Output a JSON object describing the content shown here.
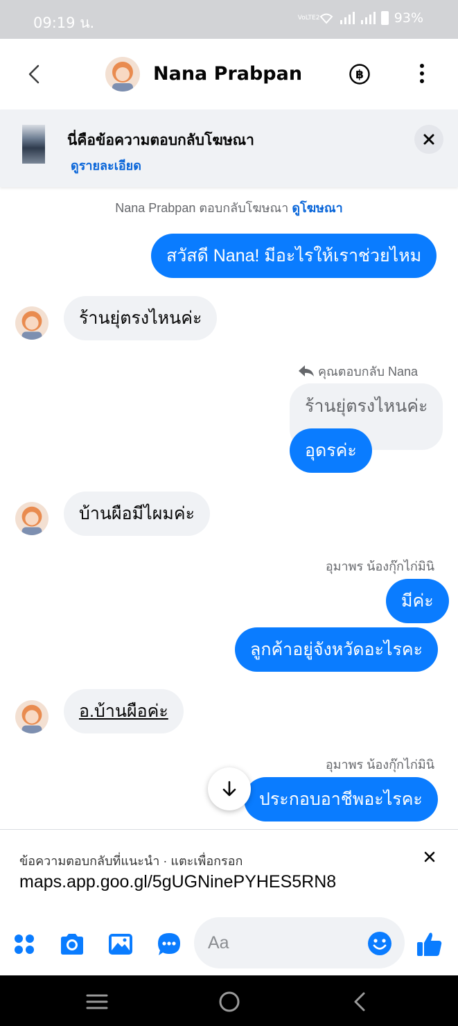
{
  "status_bar": {
    "time": "09:19 น.",
    "network": "VoLTE2",
    "battery": "93%"
  },
  "header": {
    "contact_name": "Nana Prabpan"
  },
  "ad_banner": {
    "title": "นี่คือข้อความตอบกลับโฆษณา",
    "link": "ดูรายละเอียด"
  },
  "system_notice": {
    "text": "Nana Prabpan ตอบกลับโฆษณา",
    "link": "ดูโฆษณา"
  },
  "messages": {
    "m1": "สวัสดี Nana! มีอะไรให้เราช่วยไหม",
    "m2": "ร้านยุ่ตรงไหนค่ะ",
    "reply_meta": "คุณตอบกลับ Nana",
    "reply_quoted": "ร้านยุ่ตรงไหนค่ะ",
    "m3": "อุดรค่ะ",
    "m4": "บ้านผือมีไผมค่ะ",
    "sender_1": "อุมาพร น้องกุ๊กไก่มินิ",
    "m5": "มีค่ะ",
    "m6": "ลูกค้าอยู่จังหวัดอะไรคะ",
    "m7": "อ.บ้านผือค่ะ",
    "sender_2": "อุมาพร น้องกุ๊กไก่มินิ",
    "m8": "ประกอบอาชีพอะไรคะ"
  },
  "suggestion": {
    "label": "ข้อความตอบกลับที่แนะนำ · แตะเพื่อกรอก",
    "text": "maps.app.goo.gl/5gUGNinePYHES5RN8"
  },
  "composer": {
    "placeholder": "Aa"
  },
  "colors": {
    "accent": "#0a7cff",
    "link": "#0a66d9",
    "incoming_bubble": "#f0f2f5",
    "status_bar": "#d2d3d6"
  },
  "icons": {
    "back": "back-arrow-icon",
    "baht": "baht-icon",
    "more": "more-vertical-icon",
    "close": "close-icon",
    "reply": "reply-arrow-icon",
    "scroll": "arrow-down-icon",
    "apps": "apps-icon",
    "camera": "camera-icon",
    "gallery": "gallery-icon",
    "chat": "chat-bubble-icon",
    "emoji": "emoji-icon",
    "like": "thumbs-up-icon"
  }
}
